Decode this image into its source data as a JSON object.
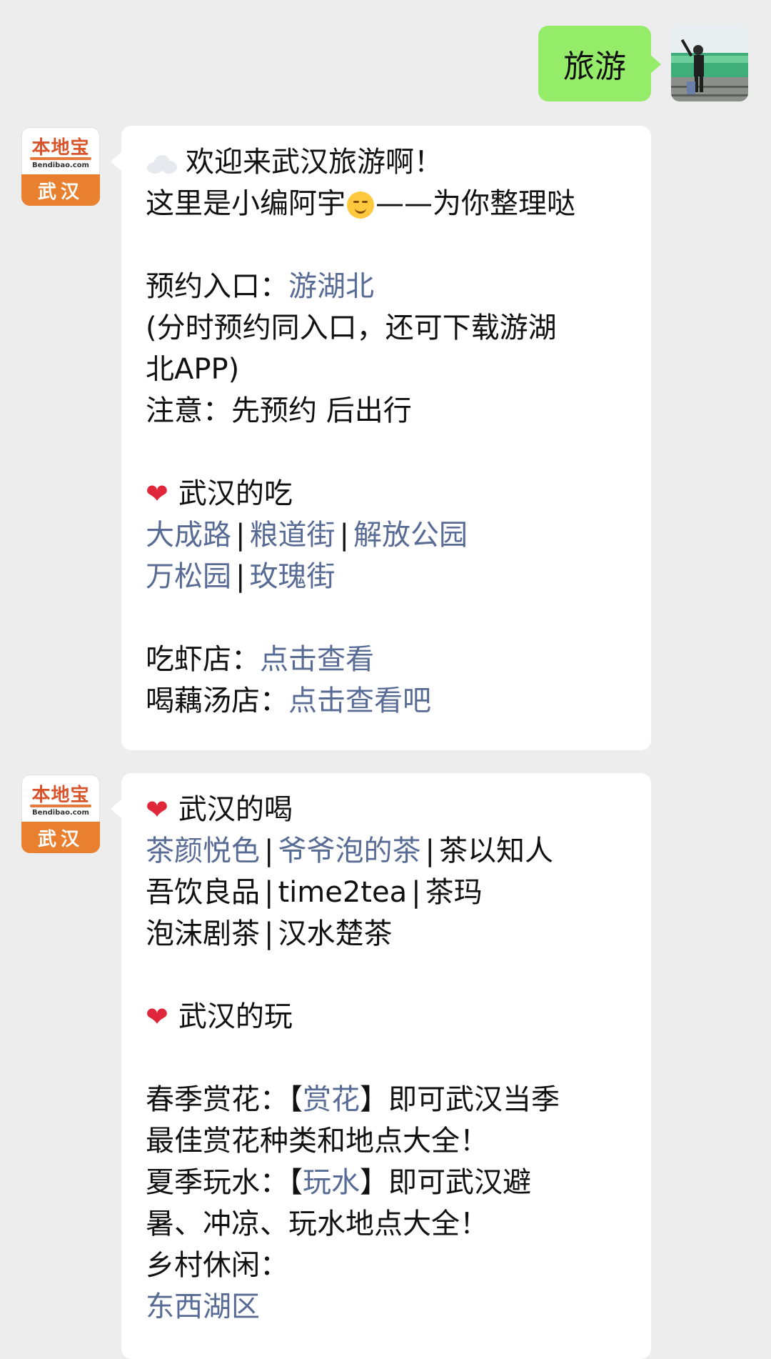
{
  "outgoing": {
    "text": "旅游"
  },
  "bot": {
    "brand": "本地宝",
    "domain": "Bendibao.com",
    "city": "武汉"
  },
  "message1": {
    "welcome": "欢迎来武汉旅游啊！",
    "intro_pre": "这里是小编阿宇",
    "intro_post": "——为你整理哒",
    "booking_label": "预约入口：",
    "booking_link": "游湖北",
    "booking_note_1": "(分时预约同入口，还可下载游湖",
    "booking_note_2": "北APP)",
    "notice": "注意：先预约 后出行",
    "eat_title": "武汉的吃",
    "eat_links_row1": [
      "大成路",
      "粮道街",
      "解放公园"
    ],
    "eat_links_row2": [
      "万松园",
      "玫瑰街"
    ],
    "shrimp_label": "吃虾店：",
    "shrimp_link": "点击查看",
    "soup_label": "喝藕汤店：",
    "soup_link": "点击查看吧"
  },
  "message2": {
    "drink_title": "武汉的喝",
    "drink_row1": [
      "茶颜悦色",
      "爷爷泡的茶",
      "茶以知人"
    ],
    "drink_row2": [
      "吾饮良品",
      "time2tea",
      "茶玛"
    ],
    "drink_row3": [
      "泡沫剧茶",
      "汉水楚茶"
    ],
    "play_title": "武汉的玩",
    "spring_label": "春季赏花：",
    "spring_bracket_open": "【",
    "spring_link": "赏花",
    "spring_bracket_close": "】",
    "spring_rest": "即可武汉当季",
    "spring_line2": "最佳赏花种类和地点大全！",
    "summer_label": "夏季玩水：",
    "summer_bracket_open": "【",
    "summer_link": "玩水",
    "summer_bracket_close": "】",
    "summer_rest": "即可武汉避",
    "summer_line2": "暑、冲凉、玩水地点大全！",
    "rural_label": "乡村休闲：",
    "rural_link": "东西湖区"
  },
  "colors": {
    "link": "#576b95",
    "outgoing_bubble": "#95ec69",
    "background": "#ededed",
    "heart": "#e0263a",
    "brand_orange": "#e8802f"
  }
}
